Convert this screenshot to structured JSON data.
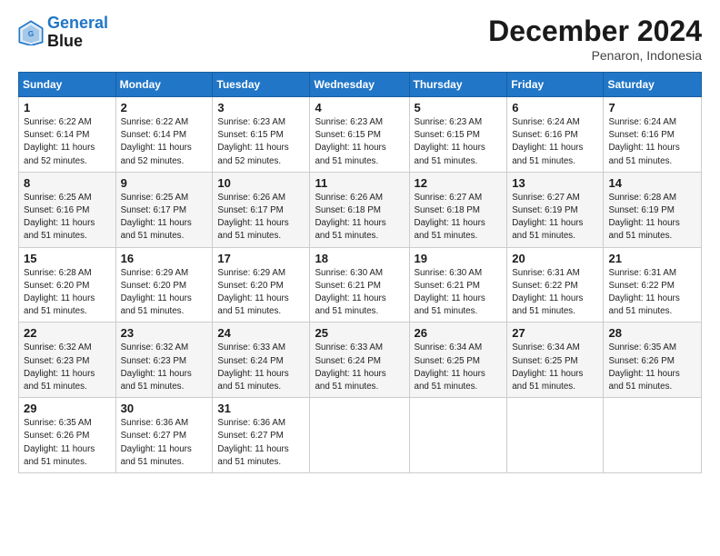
{
  "logo": {
    "line1": "General",
    "line2": "Blue"
  },
  "title": "December 2024",
  "subtitle": "Penaron, Indonesia",
  "days_header": [
    "Sunday",
    "Monday",
    "Tuesday",
    "Wednesday",
    "Thursday",
    "Friday",
    "Saturday"
  ],
  "weeks": [
    [
      {
        "day": "1",
        "info": "Sunrise: 6:22 AM\nSunset: 6:14 PM\nDaylight: 11 hours\nand 52 minutes."
      },
      {
        "day": "2",
        "info": "Sunrise: 6:22 AM\nSunset: 6:14 PM\nDaylight: 11 hours\nand 52 minutes."
      },
      {
        "day": "3",
        "info": "Sunrise: 6:23 AM\nSunset: 6:15 PM\nDaylight: 11 hours\nand 52 minutes."
      },
      {
        "day": "4",
        "info": "Sunrise: 6:23 AM\nSunset: 6:15 PM\nDaylight: 11 hours\nand 51 minutes."
      },
      {
        "day": "5",
        "info": "Sunrise: 6:23 AM\nSunset: 6:15 PM\nDaylight: 11 hours\nand 51 minutes."
      },
      {
        "day": "6",
        "info": "Sunrise: 6:24 AM\nSunset: 6:16 PM\nDaylight: 11 hours\nand 51 minutes."
      },
      {
        "day": "7",
        "info": "Sunrise: 6:24 AM\nSunset: 6:16 PM\nDaylight: 11 hours\nand 51 minutes."
      }
    ],
    [
      {
        "day": "8",
        "info": "Sunrise: 6:25 AM\nSunset: 6:16 PM\nDaylight: 11 hours\nand 51 minutes."
      },
      {
        "day": "9",
        "info": "Sunrise: 6:25 AM\nSunset: 6:17 PM\nDaylight: 11 hours\nand 51 minutes."
      },
      {
        "day": "10",
        "info": "Sunrise: 6:26 AM\nSunset: 6:17 PM\nDaylight: 11 hours\nand 51 minutes."
      },
      {
        "day": "11",
        "info": "Sunrise: 6:26 AM\nSunset: 6:18 PM\nDaylight: 11 hours\nand 51 minutes."
      },
      {
        "day": "12",
        "info": "Sunrise: 6:27 AM\nSunset: 6:18 PM\nDaylight: 11 hours\nand 51 minutes."
      },
      {
        "day": "13",
        "info": "Sunrise: 6:27 AM\nSunset: 6:19 PM\nDaylight: 11 hours\nand 51 minutes."
      },
      {
        "day": "14",
        "info": "Sunrise: 6:28 AM\nSunset: 6:19 PM\nDaylight: 11 hours\nand 51 minutes."
      }
    ],
    [
      {
        "day": "15",
        "info": "Sunrise: 6:28 AM\nSunset: 6:20 PM\nDaylight: 11 hours\nand 51 minutes."
      },
      {
        "day": "16",
        "info": "Sunrise: 6:29 AM\nSunset: 6:20 PM\nDaylight: 11 hours\nand 51 minutes."
      },
      {
        "day": "17",
        "info": "Sunrise: 6:29 AM\nSunset: 6:20 PM\nDaylight: 11 hours\nand 51 minutes."
      },
      {
        "day": "18",
        "info": "Sunrise: 6:30 AM\nSunset: 6:21 PM\nDaylight: 11 hours\nand 51 minutes."
      },
      {
        "day": "19",
        "info": "Sunrise: 6:30 AM\nSunset: 6:21 PM\nDaylight: 11 hours\nand 51 minutes."
      },
      {
        "day": "20",
        "info": "Sunrise: 6:31 AM\nSunset: 6:22 PM\nDaylight: 11 hours\nand 51 minutes."
      },
      {
        "day": "21",
        "info": "Sunrise: 6:31 AM\nSunset: 6:22 PM\nDaylight: 11 hours\nand 51 minutes."
      }
    ],
    [
      {
        "day": "22",
        "info": "Sunrise: 6:32 AM\nSunset: 6:23 PM\nDaylight: 11 hours\nand 51 minutes."
      },
      {
        "day": "23",
        "info": "Sunrise: 6:32 AM\nSunset: 6:23 PM\nDaylight: 11 hours\nand 51 minutes."
      },
      {
        "day": "24",
        "info": "Sunrise: 6:33 AM\nSunset: 6:24 PM\nDaylight: 11 hours\nand 51 minutes."
      },
      {
        "day": "25",
        "info": "Sunrise: 6:33 AM\nSunset: 6:24 PM\nDaylight: 11 hours\nand 51 minutes."
      },
      {
        "day": "26",
        "info": "Sunrise: 6:34 AM\nSunset: 6:25 PM\nDaylight: 11 hours\nand 51 minutes."
      },
      {
        "day": "27",
        "info": "Sunrise: 6:34 AM\nSunset: 6:25 PM\nDaylight: 11 hours\nand 51 minutes."
      },
      {
        "day": "28",
        "info": "Sunrise: 6:35 AM\nSunset: 6:26 PM\nDaylight: 11 hours\nand 51 minutes."
      }
    ],
    [
      {
        "day": "29",
        "info": "Sunrise: 6:35 AM\nSunset: 6:26 PM\nDaylight: 11 hours\nand 51 minutes."
      },
      {
        "day": "30",
        "info": "Sunrise: 6:36 AM\nSunset: 6:27 PM\nDaylight: 11 hours\nand 51 minutes."
      },
      {
        "day": "31",
        "info": "Sunrise: 6:36 AM\nSunset: 6:27 PM\nDaylight: 11 hours\nand 51 minutes."
      },
      {
        "day": "",
        "info": ""
      },
      {
        "day": "",
        "info": ""
      },
      {
        "day": "",
        "info": ""
      },
      {
        "day": "",
        "info": ""
      }
    ]
  ]
}
